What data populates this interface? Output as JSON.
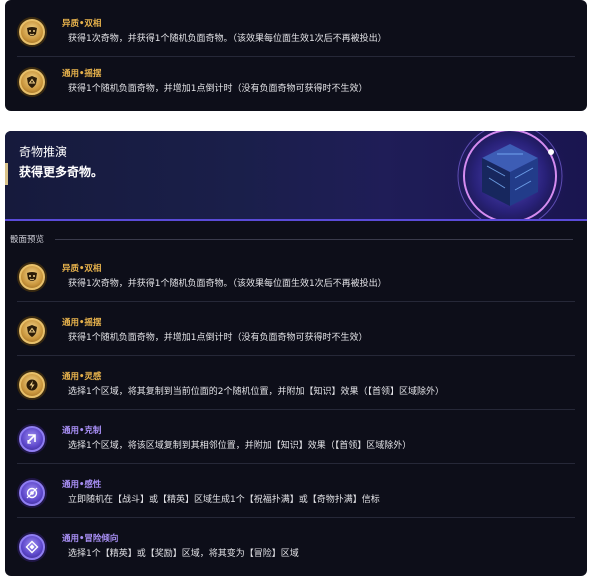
{
  "top_effects": [
    {
      "title": "异质•双相",
      "desc": "获得1次奇物，并获得1个随机负面奇物。（该效果每位面生效1次后不再被投出）",
      "color": "gold",
      "icon": "mask-icon"
    },
    {
      "title": "通用•摇摆",
      "desc": "获得1个随机负面奇物，并增加1点倒计时（没有负面奇物可获得时不生效）",
      "color": "gold",
      "icon": "shield-swing-icon"
    }
  ],
  "header": {
    "title": "奇物推演",
    "desc": "获得更多奇物。"
  },
  "section_label": "骰面预览",
  "effects": [
    {
      "title": "异质•双相",
      "desc": "获得1次奇物，并获得1个随机负面奇物。（该效果每位面生效1次后不再被投出）",
      "color": "gold",
      "icon": "mask-icon"
    },
    {
      "title": "通用•摇摆",
      "desc": "获得1个随机负面奇物，并增加1点倒计时（没有负面奇物可获得时不生效）",
      "color": "gold",
      "icon": "shield-swing-icon"
    },
    {
      "title": "通用•灵感",
      "desc": "选择1个区域，将其复制到当前位面的2个随机位置，并附加【知识】效果（【首领】区域除外）",
      "color": "gold",
      "icon": "lightning-icon"
    },
    {
      "title": "通用•克制",
      "desc": "选择1个区域，将该区域复制到其相邻位置，并附加【知识】效果（【首领】区域除外）",
      "color": "purple",
      "icon": "arrow-restrain-icon"
    },
    {
      "title": "通用•感性",
      "desc": "立即随机在【战斗】或【精英】区域生成1个【祝福扑满】或【奇物扑满】信标",
      "color": "purple",
      "icon": "eye-icon"
    },
    {
      "title": "通用•冒险倾向",
      "desc": "选择1个【精英】或【奖励】区域，将其变为【冒险】区域",
      "color": "purple",
      "icon": "diamond-icon"
    }
  ]
}
